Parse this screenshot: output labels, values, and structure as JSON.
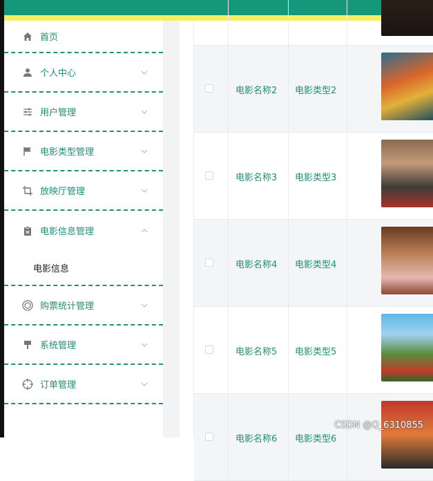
{
  "menu": {
    "items": [
      {
        "label": "首页",
        "icon": "home-icon"
      },
      {
        "label": "个人中心",
        "icon": "user-icon"
      },
      {
        "label": "用户管理",
        "icon": "sliders-icon"
      },
      {
        "label": "电影类型管理",
        "icon": "flag-icon"
      },
      {
        "label": "放映厅管理",
        "icon": "crop-icon"
      },
      {
        "label": "电影信息管理",
        "icon": "clipboard-icon"
      },
      {
        "label": "购票统计管理",
        "icon": "target-icon"
      },
      {
        "label": "系统管理",
        "icon": "stamp-icon"
      },
      {
        "label": "订单管理",
        "icon": "crosshair-icon"
      }
    ],
    "sub_item": "电影信息"
  },
  "table": {
    "rows": [
      {
        "name": "电影名称2",
        "type": "电影类型2"
      },
      {
        "name": "电影名称3",
        "type": "电影类型3"
      },
      {
        "name": "电影名称4",
        "type": "电影类型4"
      },
      {
        "name": "电影名称5",
        "type": "电影类型5"
      },
      {
        "name": "电影名称6",
        "type": "电影类型6"
      }
    ]
  },
  "watermark": "CSDN @Q_6310855",
  "colors": {
    "accent": "#1d8f75",
    "topbar": "#15977a",
    "topbar_underline": "#f6ef65"
  }
}
